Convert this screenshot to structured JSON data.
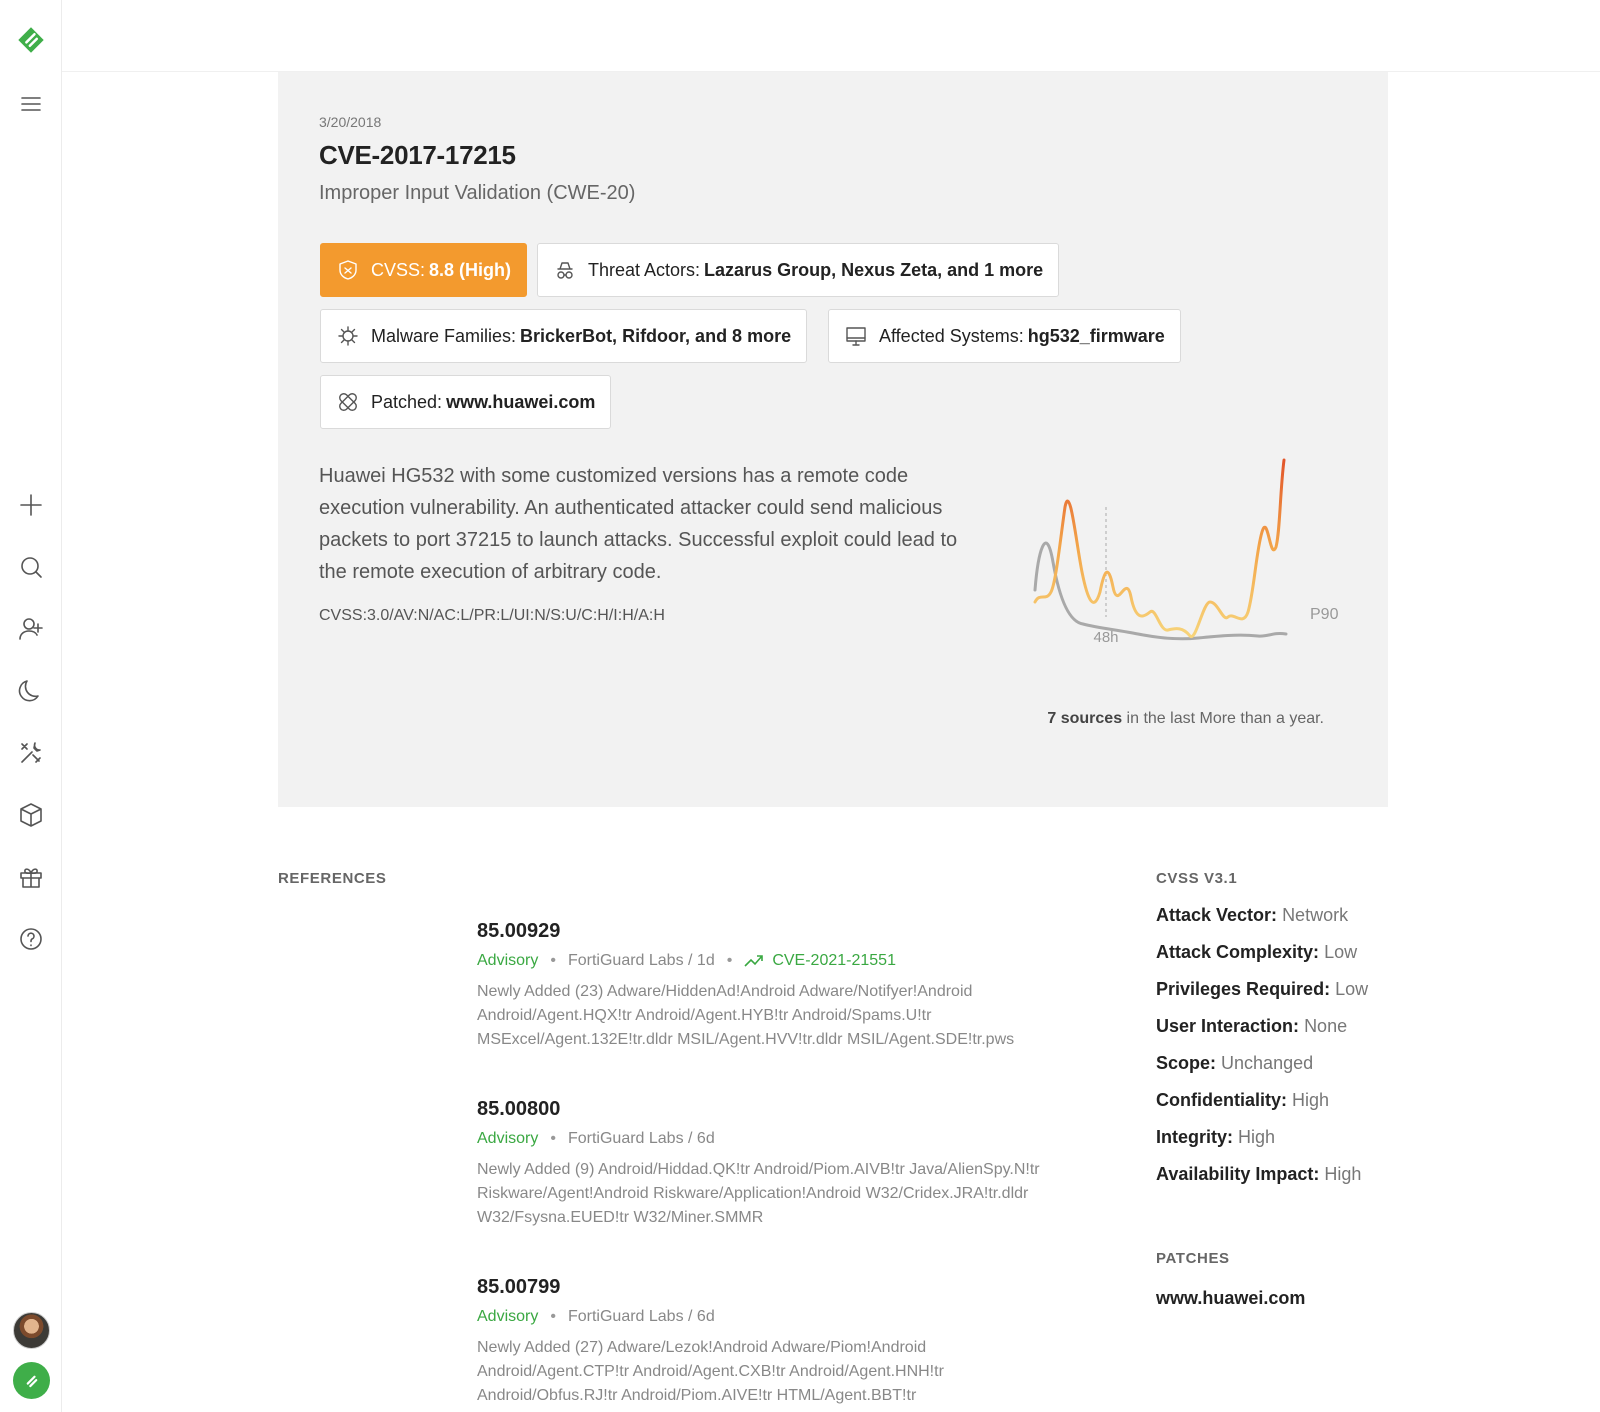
{
  "rail": {
    "top_icons": [
      "logo-icon",
      "menu-icon"
    ],
    "icons": [
      "plus-icon",
      "search-icon",
      "add-user-icon",
      "moon-icon",
      "tools-icon",
      "box-icon",
      "gift-icon",
      "help-icon"
    ]
  },
  "hero": {
    "date": "3/20/2018",
    "title": "CVE-2017-17215",
    "subtitle": "Improper Input Validation (CWE-20)",
    "cvss": {
      "label": "CVSS:",
      "value": "8.8 (High)",
      "color": "#f39a2e"
    },
    "threat_actors": {
      "label": "Threat Actors:",
      "value": "Lazarus Group, Nexus Zeta, and 1 more"
    },
    "malware": {
      "label": "Malware Families:",
      "value": "BrickerBot, Rifdoor, and 8 more"
    },
    "affected": {
      "label": "Affected Systems:",
      "value": "hg532_firmware"
    },
    "patched": {
      "label": "Patched:",
      "value": "www.huawei.com"
    },
    "description": "Huawei HG532 with some customized versions has a remote code execution vulnerability. An authenticated attacker could send malicious packets to port 37215 to launch attacks. Successful exploit could lead to the remote execution of arbitrary code.",
    "vector": "CVSS:3.0/AV:N/AC:L/PR:L/UI:N/S:U/C:H/I:H/A:H",
    "chart": {
      "marker_label": "48h",
      "percentile_label": "P90",
      "sources_count": "7 sources",
      "sources_suffix": " in the last More than a year."
    }
  },
  "references": {
    "heading": "REFERENCES",
    "items": [
      {
        "id": "85.00929",
        "type": "Advisory",
        "source": "FortiGuard Labs / 1d",
        "trend": "CVE-2021-21551",
        "body": "Newly Added (23) Adware/HiddenAd!Android Adware/Notifyer!Android Android/Agent.HQX!tr Android/Agent.HYB!tr Android/Spams.U!tr MSExcel/Agent.132E!tr.dldr MSIL/Agent.HVV!tr.dldr MSIL/Agent.SDE!tr.pws"
      },
      {
        "id": "85.00800",
        "type": "Advisory",
        "source": "FortiGuard Labs / 6d",
        "body": "Newly Added (9) Android/Hiddad.QK!tr Android/Piom.AIVB!tr Java/AlienSpy.N!tr Riskware/Agent!Android Riskware/Application!Android W32/Cridex.JRA!tr.dldr W32/Fsysna.EUED!tr W32/Miner.SMMR"
      },
      {
        "id": "85.00799",
        "type": "Advisory",
        "source": "FortiGuard Labs / 6d",
        "body": "Newly Added (27) Adware/Lezok!Android Adware/Piom!Android Android/Agent.CTP!tr Android/Agent.CXB!tr Android/Agent.HNH!tr Android/Obfus.RJ!tr Android/Piom.AIVE!tr HTML/Agent.BBT!tr"
      }
    ]
  },
  "cvss31": {
    "heading": "CVSS V3.1",
    "rows": [
      {
        "key": "Attack Vector:",
        "value": "Network"
      },
      {
        "key": "Attack Complexity:",
        "value": "Low"
      },
      {
        "key": "Privileges Required:",
        "value": "Low"
      },
      {
        "key": "User Interaction:",
        "value": "None"
      },
      {
        "key": "Scope:",
        "value": "Unchanged"
      },
      {
        "key": "Confidentiality:",
        "value": "High"
      },
      {
        "key": "Integrity:",
        "value": "High"
      },
      {
        "key": "Availability Impact:",
        "value": "High"
      }
    ]
  },
  "patches": {
    "heading": "PATCHES",
    "link": "www.huawei.com"
  }
}
